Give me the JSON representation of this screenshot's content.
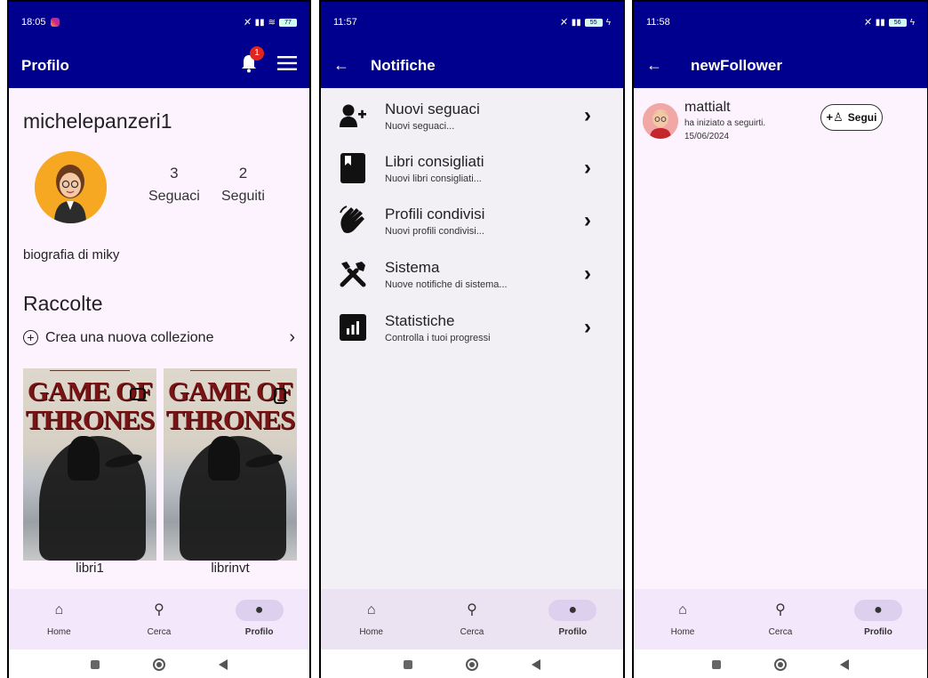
{
  "panel1": {
    "status_time": "18:05",
    "status_battery": "77",
    "title": "Profilo",
    "notification_count": "1",
    "username": "michelepanzeri1",
    "followers_count": "3",
    "followers_label": "Seguaci",
    "following_count": "2",
    "following_label": "Seguiti",
    "bio": "biografia di miky",
    "collections_title": "Raccolte",
    "new_collection_label": "Crea una nuova collezione",
    "collections": [
      {
        "cover_title": "GAME OF THRONES",
        "name": "libri1"
      },
      {
        "cover_title": "GAME OF THRONES",
        "name": "librinvt"
      }
    ]
  },
  "panel2": {
    "status_time": "11:57",
    "status_battery": "55",
    "title": "Notifiche",
    "items": [
      {
        "title": "Nuovi seguaci",
        "subtitle": "Nuovi seguaci...",
        "icon": "person-add-icon"
      },
      {
        "title": "Libri consigliati",
        "subtitle": "Nuovi libri consigliati...",
        "icon": "book-icon"
      },
      {
        "title": "Profili condivisi",
        "subtitle": "Nuovi profili condivisi...",
        "icon": "wave-hand-icon"
      },
      {
        "title": "Sistema",
        "subtitle": "Nuove notifiche di sistema...",
        "icon": "tools-icon"
      },
      {
        "title": "Statistiche",
        "subtitle": "Controlla i tuoi progressi",
        "icon": "stats-icon"
      }
    ]
  },
  "panel3": {
    "status_time": "11:58",
    "status_battery": "56",
    "title": "newFollower",
    "follower": {
      "name": "mattialt",
      "message": "ha iniziato a seguirti.",
      "date": "15/06/2024",
      "button_label": "Segui"
    }
  },
  "bottom_nav": {
    "home": "Home",
    "search": "Cerca",
    "profile": "Profilo"
  },
  "colors": {
    "appbar": "#00008f",
    "badge": "#e0251f",
    "nav_bg": "#f2e7fb"
  }
}
